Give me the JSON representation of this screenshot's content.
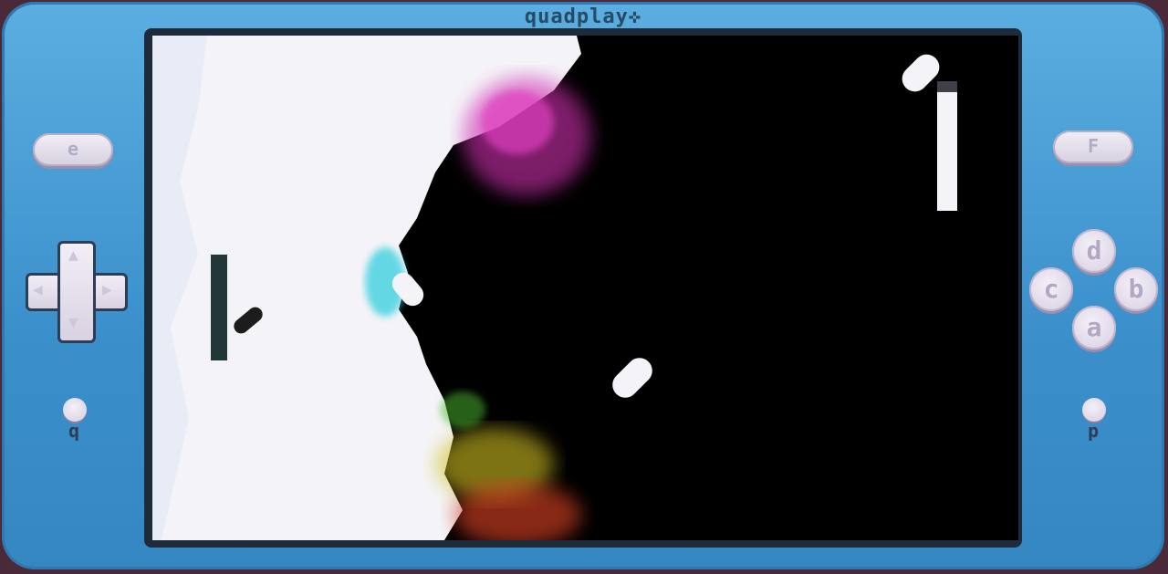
{
  "device": {
    "brand": "quadplay✜"
  },
  "buttons": {
    "e_label": "e",
    "f_label": "F",
    "a_label": "a",
    "b_label": "b",
    "c_label": "c",
    "d_label": "d",
    "q_label": "q",
    "p_label": "p"
  },
  "icons": {
    "dpad": "dpad-icon",
    "up": "▲",
    "down": "▼",
    "left": "◀",
    "right": "▶"
  },
  "colors": {
    "console_blue": "#3a8fcb",
    "screen_bg": "#000000",
    "light_side": "#f4f4f8",
    "particle_magenta": "#d030b0",
    "particle_cyan": "#40d0e0",
    "particle_yellow": "#d0c020",
    "particle_red": "#d04020"
  }
}
